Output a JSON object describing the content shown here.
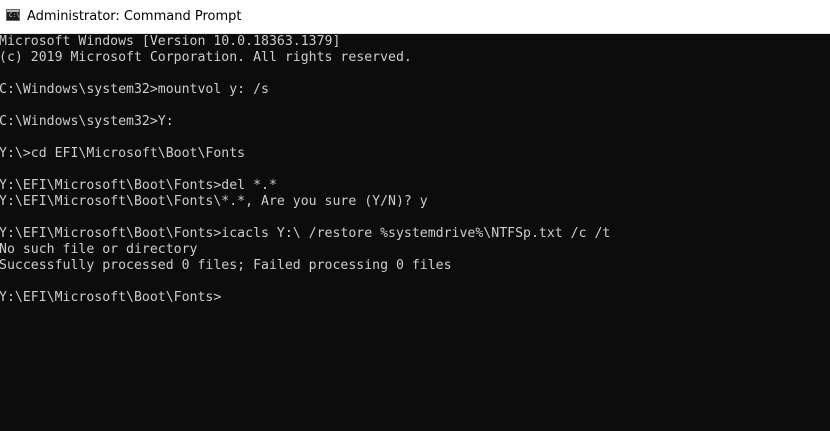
{
  "window": {
    "title": "Administrator: Command Prompt",
    "icon": "cmd-icon",
    "icon_glyph": "C:\\"
  },
  "console": {
    "lines": [
      "Microsoft Windows [Version 10.0.18363.1379]",
      "(c) 2019 Microsoft Corporation. All rights reserved.",
      "",
      "C:\\Windows\\system32>mountvol y: /s",
      "",
      "C:\\Windows\\system32>Y:",
      "",
      "Y:\\>cd EFI\\Microsoft\\Boot\\Fonts",
      "",
      "Y:\\EFI\\Microsoft\\Boot\\Fonts>del *.*",
      "Y:\\EFI\\Microsoft\\Boot\\Fonts\\*.*, Are you sure (Y/N)? y",
      "",
      "Y:\\EFI\\Microsoft\\Boot\\Fonts>icacls Y:\\ /restore %systemdrive%\\NTFSp.txt /c /t",
      "No such file or directory",
      "Successfully processed 0 files; Failed processing 0 files",
      "",
      "Y:\\EFI\\Microsoft\\Boot\\Fonts>"
    ]
  },
  "colors": {
    "console_background": "#0c0c0c",
    "console_text": "#cccccc",
    "titlebar_background": "#ffffff"
  }
}
